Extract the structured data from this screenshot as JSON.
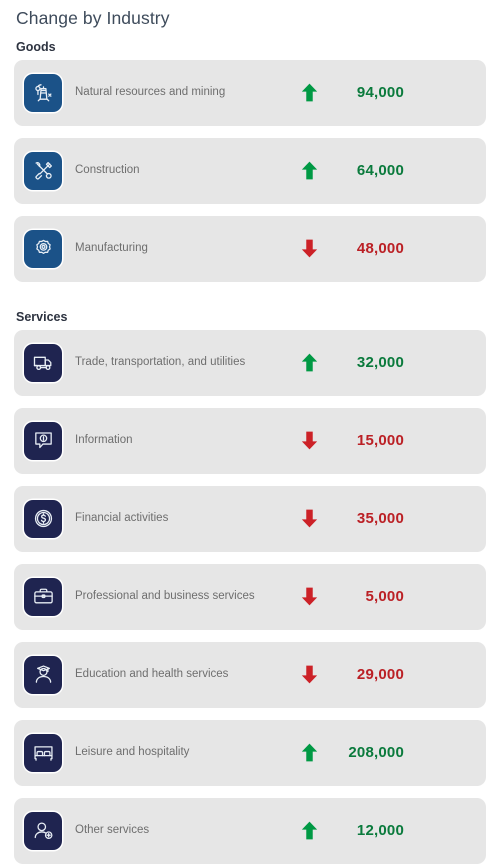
{
  "header": {
    "title": "Change by Industry"
  },
  "colors": {
    "goods_icon_bg": "#1b5288",
    "services_icon_bg": "#1f2450",
    "row_bg": "#e6e6e6",
    "increase": "#0a7a3c",
    "decrease": "#bb2025",
    "title": "#3e4b5b",
    "label": "#6e6e6e"
  },
  "groups": [
    {
      "id": "goods",
      "label": "Goods",
      "rows": [
        {
          "label": "Natural resources and mining",
          "icon": "oil-derrick-icon",
          "direction": "up",
          "direction_label": "increase-arrow-icon",
          "value": "94,000"
        },
        {
          "label": "Construction",
          "icon": "hammer-wrench-icon",
          "direction": "up",
          "direction_label": "increase-arrow-icon",
          "value": "64,000"
        },
        {
          "label": "Manufacturing",
          "icon": "gear-icon",
          "direction": "down",
          "direction_label": "decrease-arrow-icon",
          "value": "48,000"
        }
      ]
    },
    {
      "id": "services",
      "label": "Services",
      "rows": [
        {
          "label": "Trade, transportation, and utilities",
          "icon": "truck-icon",
          "direction": "up",
          "direction_label": "increase-arrow-icon",
          "value": "32,000"
        },
        {
          "label": "Information",
          "icon": "info-speech-bubble-icon",
          "direction": "down",
          "direction_label": "decrease-arrow-icon",
          "value": "15,000"
        },
        {
          "label": "Financial activities",
          "icon": "dollar-coin-icon",
          "direction": "down",
          "direction_label": "decrease-arrow-icon",
          "value": "35,000"
        },
        {
          "label": "Professional and business services",
          "icon": "briefcase-icon",
          "direction": "down",
          "direction_label": "decrease-arrow-icon",
          "value": "5,000"
        },
        {
          "label": "Education and health services",
          "icon": "graduate-person-icon",
          "direction": "down",
          "direction_label": "decrease-arrow-icon",
          "value": "29,000"
        },
        {
          "label": "Leisure and hospitality",
          "icon": "bed-icon",
          "direction": "up",
          "direction_label": "increase-arrow-icon",
          "value": "208,000"
        },
        {
          "label": "Other services",
          "icon": "person-add-icon",
          "direction": "up",
          "direction_label": "increase-arrow-icon",
          "value": "12,000"
        }
      ]
    }
  ]
}
